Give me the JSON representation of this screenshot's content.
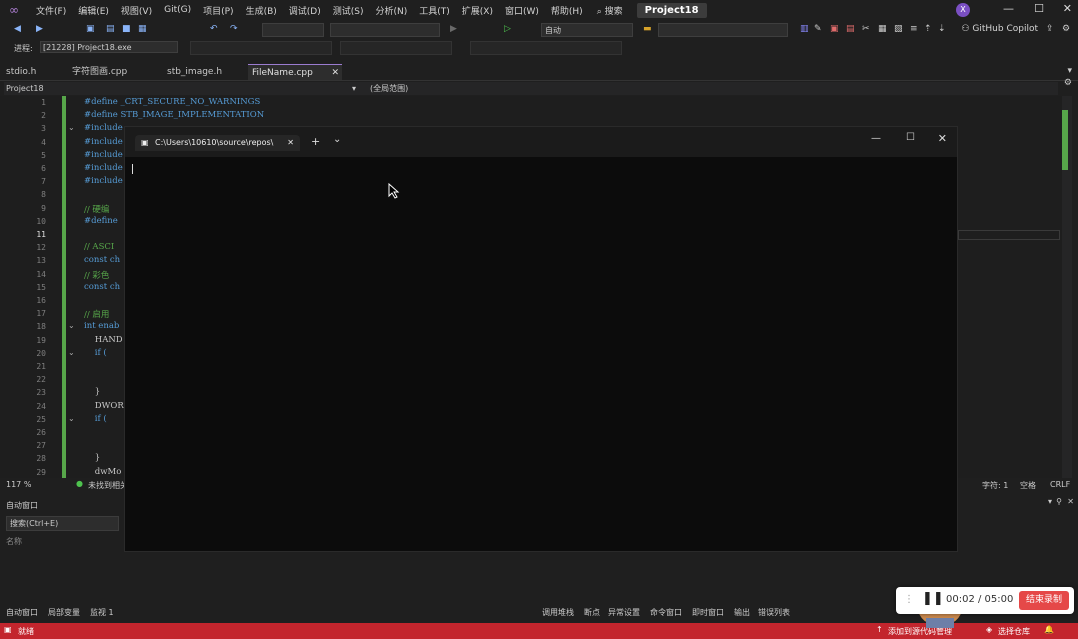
{
  "menu": {
    "items": [
      "文件(F)",
      "编辑(E)",
      "视图(V)",
      "Git(G)",
      "项目(P)",
      "生成(B)",
      "调试(D)",
      "测试(S)",
      "分析(N)",
      "工具(T)",
      "扩展(X)",
      "窗口(W)",
      "帮助(H)"
    ],
    "search": "搜索",
    "project": "Project18",
    "avatar": "X"
  },
  "toolbar": {
    "config": "自动",
    "copilot": "GitHub Copilot"
  },
  "process": {
    "label": "进程:",
    "value": "[21228] Project18.exe"
  },
  "tabs": [
    {
      "label": "stdio.h"
    },
    {
      "label": "字符图画.cpp"
    },
    {
      "label": "stb_image.h"
    },
    {
      "label": "FileName.cpp",
      "active": true
    }
  ],
  "nav": {
    "project": "Project18",
    "scope": "(全局范围)"
  },
  "editor": {
    "lines": [
      {
        "n": "1",
        "t": "#define _CRT_SECURE_NO_WARNINGS",
        "c": "kw"
      },
      {
        "n": "2",
        "t": "#define STB_IMAGE_IMPLEMENTATION",
        "c": "kw"
      },
      {
        "n": "3",
        "t": "#include",
        "c": "kw"
      },
      {
        "n": "4",
        "t": "#include",
        "c": "kw"
      },
      {
        "n": "5",
        "t": "#include",
        "c": "kw"
      },
      {
        "n": "6",
        "t": "#include",
        "c": "kw"
      },
      {
        "n": "7",
        "t": "#include",
        "c": "kw"
      },
      {
        "n": "8",
        "t": "",
        "c": "ty"
      },
      {
        "n": "9",
        "t": "// 硬编",
        "c": "cm"
      },
      {
        "n": "10",
        "t": "#define",
        "c": "kw"
      },
      {
        "n": "11",
        "t": "",
        "c": "ty"
      },
      {
        "n": "12",
        "t": "// ASCI",
        "c": "cm"
      },
      {
        "n": "13",
        "t": "const ch",
        "c": "kw"
      },
      {
        "n": "14",
        "t": "// 彩色",
        "c": "cm"
      },
      {
        "n": "15",
        "t": "const ch",
        "c": "kw"
      },
      {
        "n": "16",
        "t": "",
        "c": "ty"
      },
      {
        "n": "17",
        "t": "// 启用",
        "c": "cm"
      },
      {
        "n": "18",
        "t": "int enab",
        "c": "kw"
      },
      {
        "n": "19",
        "t": "    HAND",
        "c": "ty"
      },
      {
        "n": "20",
        "t": "    if (",
        "c": "kw"
      },
      {
        "n": "21",
        "t": "",
        "c": "ty"
      },
      {
        "n": "22",
        "t": "",
        "c": "ty"
      },
      {
        "n": "23",
        "t": "    }",
        "c": "ty"
      },
      {
        "n": "24",
        "t": "    DWOR",
        "c": "ty"
      },
      {
        "n": "25",
        "t": "    if (",
        "c": "kw"
      },
      {
        "n": "26",
        "t": "",
        "c": "ty"
      },
      {
        "n": "27",
        "t": "",
        "c": "ty"
      },
      {
        "n": "28",
        "t": "    }",
        "c": "ty"
      },
      {
        "n": "29",
        "t": "    dwMo",
        "c": "ty"
      }
    ],
    "zoom": "117 %",
    "issues": "未找到相关问题",
    "col": "字符: 1",
    "tab": "空格",
    "eol": "CRLF"
  },
  "auto_window": {
    "title": "自动窗口",
    "search": "搜索(Ctrl+E)",
    "col": "名称"
  },
  "bottom_tabs": {
    "left": [
      "自动窗口",
      "局部变量",
      "监视 1"
    ],
    "right": [
      "调用堆栈",
      "断点",
      "异常设置",
      "命令窗口",
      "即时窗口",
      "输出",
      "错误列表"
    ]
  },
  "statusbar": {
    "ready": "就绪",
    "add": "添加到源代码管理",
    "repo": "选择仓库"
  },
  "terminal": {
    "tab": "C:\\Users\\10610\\source\\repos\\",
    "new_tab": "+",
    "dropdown": "⌄"
  },
  "recorder": {
    "time": "00:02 / 05:00",
    "stop": "结束录制"
  }
}
